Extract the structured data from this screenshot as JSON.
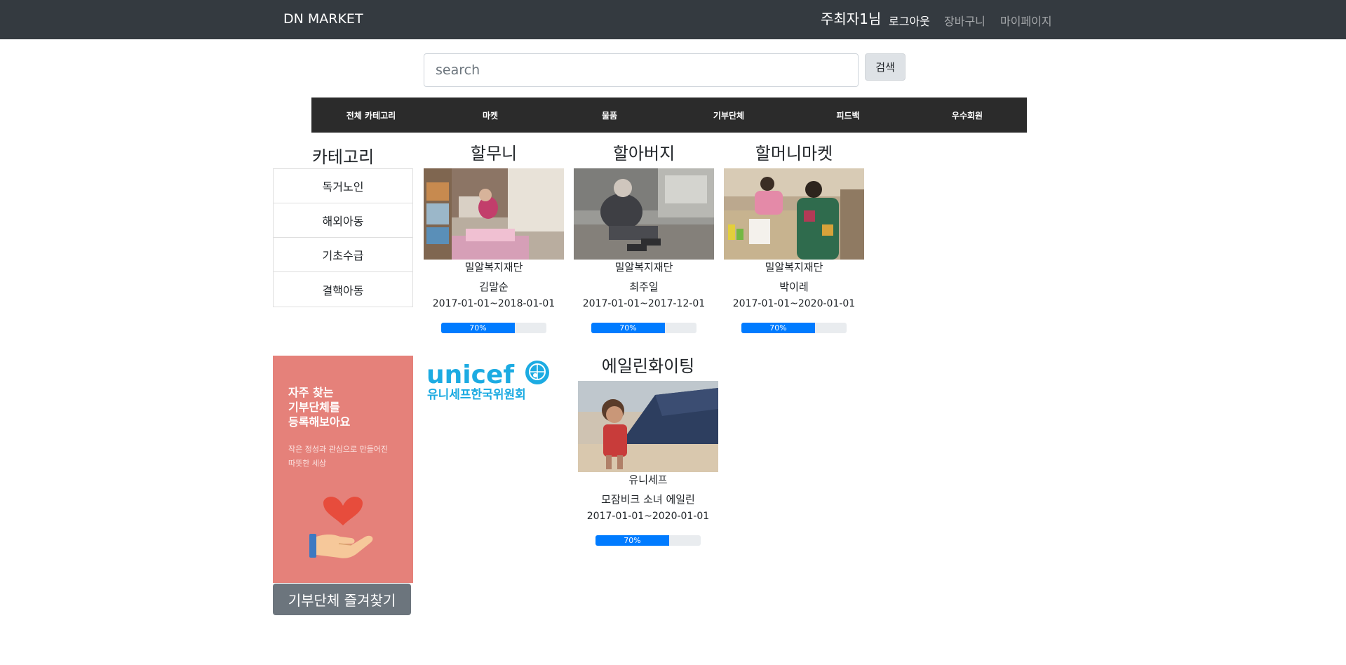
{
  "navbar": {
    "brand": "DN MARKET",
    "user": "주최자1님",
    "logout": "로그아웃",
    "cart": "장바구니",
    "mypage": "마이페이지"
  },
  "search": {
    "placeholder": "search",
    "button": "검색"
  },
  "menu": [
    "전체 카테고리",
    "마켓",
    "물품",
    "기부단체",
    "피드백",
    "우수회원"
  ],
  "sidebar": {
    "title": "카테고리",
    "items": [
      "독거노인",
      "해외아동",
      "기초수급",
      "결핵아동"
    ]
  },
  "banner": {
    "heading": [
      "자주 찾는",
      "기부단체를",
      "등록해보아요"
    ],
    "sub": [
      "작은 정성과 관심으로 만들어진",
      "따뜻한 세상"
    ],
    "colors": {
      "background": "#e5817a",
      "heart": "#e74c3c"
    }
  },
  "favorite_button": "기부단체 즐겨찾기",
  "unicef": {
    "line1": "unicef",
    "line2": "유니세프한국위원회",
    "color": "#1cabe2"
  },
  "cards": [
    {
      "title": "할무니",
      "org": "밀알복지재단",
      "person": "김말순",
      "period": "2017-01-01~2018-01-01",
      "progress": 70,
      "progress_label": "70%"
    },
    {
      "title": "할아버지",
      "org": "밀알복지재단",
      "person": "최주일",
      "period": "2017-01-01~2017-12-01",
      "progress": 70,
      "progress_label": "70%"
    },
    {
      "title": "할머니마켓",
      "org": "밀알복지재단",
      "person": "박이레",
      "period": "2017-01-01~2020-01-01",
      "progress": 70,
      "progress_label": "70%"
    },
    {
      "title": "에일린화이팅",
      "org": "유니세프",
      "person": "모잠비크 소녀 에일린",
      "period": "2017-01-01~2020-01-01",
      "progress": 70,
      "progress_label": "70%"
    }
  ]
}
